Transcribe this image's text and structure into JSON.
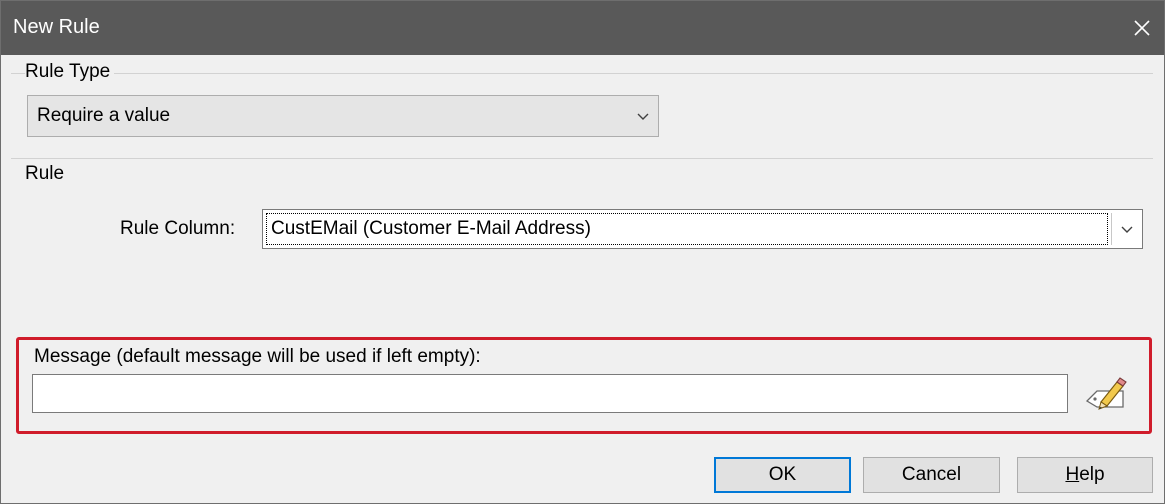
{
  "window": {
    "title": "New Rule",
    "close_icon": "close-icon"
  },
  "rule_type": {
    "group_label": "Rule Type",
    "selected": "Require a value"
  },
  "rule": {
    "group_label": "Rule",
    "column_label": "Rule Column:",
    "column_selected": "CustEMail  (Customer E-Mail Address)"
  },
  "message": {
    "label": "Message (default message will be used if left empty):",
    "value": "",
    "edit_icon": "pencil-edit-icon"
  },
  "buttons": {
    "ok": "OK",
    "cancel": "Cancel",
    "help_first": "H",
    "help_rest": "elp"
  },
  "colors": {
    "titlebar": "#595959",
    "highlight": "#d01c2b",
    "default_button_border": "#0078d7"
  }
}
